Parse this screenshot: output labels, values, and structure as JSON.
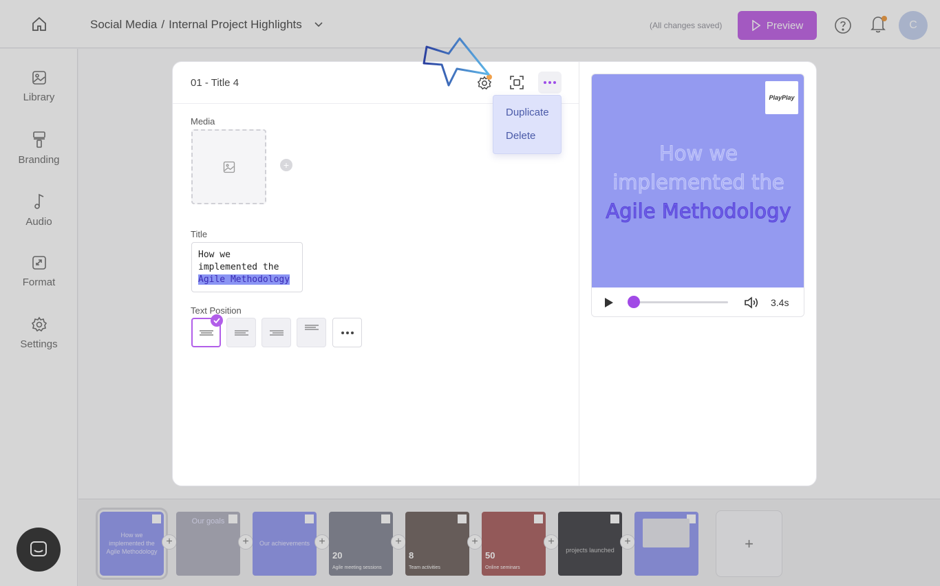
{
  "topbar": {
    "breadcrumb_parent": "Social Media",
    "breadcrumb_sep": "/",
    "breadcrumb_current": "Internal Project Highlights",
    "save_status": "(All changes saved)",
    "preview_label": "Preview",
    "avatar_initial": "C"
  },
  "sidebar": {
    "items": [
      {
        "label": "Library",
        "icon": "image-icon"
      },
      {
        "label": "Branding",
        "icon": "paint-roller-icon"
      },
      {
        "label": "Audio",
        "icon": "music-note-icon"
      },
      {
        "label": "Format",
        "icon": "resize-icon"
      },
      {
        "label": "Settings",
        "icon": "gear-icon"
      }
    ]
  },
  "editor": {
    "slide_title": "01 - Title 4",
    "menu": {
      "duplicate": "Duplicate",
      "delete": "Delete"
    },
    "media_label": "Media",
    "title_label": "Title",
    "title_line1": "How we",
    "title_line2": "implemented the",
    "title_line3": "Agile Methodology",
    "text_position_label": "Text Position",
    "text_position_selected": 0
  },
  "preview": {
    "logo_text": "PlayPlay",
    "line1": "How we",
    "line2": "implemented the",
    "line3": "Agile Methodology",
    "duration": "3.4s",
    "progress": 0,
    "canvas_color": "#949af0"
  },
  "timeline": {
    "slides": [
      {
        "text": "How we implemented the Agile Methodology",
        "color": "#9aa0f2"
      },
      {
        "text": "Our goals",
        "color": "#b7b7c4"
      },
      {
        "text": "Our achievements",
        "color": "#9aa0f2"
      },
      {
        "num": "20",
        "small": "Agile meeting sessions",
        "color": "#8d8f9c"
      },
      {
        "num": "8",
        "small": "Team activities",
        "color": "#7a6e6a"
      },
      {
        "num": "50",
        "small": "Online seminars",
        "color": "#b06a6a"
      },
      {
        "small": "projects launched",
        "color": "#505055"
      },
      {
        "small": "",
        "color": "#9aa0f2"
      }
    ],
    "add_symbol": "+"
  },
  "colors": {
    "accent": "#b15ee9",
    "preview_button": "#c36be6",
    "notification_dot": "#f0a04b"
  }
}
